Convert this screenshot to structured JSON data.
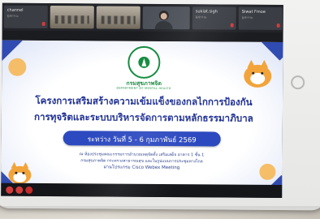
{
  "participants": [
    {
      "name": "channel",
      "status": "ผู้เข้าร่วม"
    },
    {
      "name": "",
      "status": ""
    },
    {
      "name": "",
      "status": ""
    },
    {
      "name": "",
      "status": ""
    },
    {
      "name": "sukiat.sigh",
      "status": "ผู้เข้าร่วม"
    },
    {
      "name": "Siwat Fmoe",
      "status": "ผู้เข้าร่วม"
    }
  ],
  "slide": {
    "logo_text": "กรมสุขภาพจิต",
    "logo_sub": "DEPARTMENT OF MENTAL HEALTH",
    "title_line1": "โครงการเสริมสร้างความเข้มแข็งของกลไกการป้องกัน",
    "title_line2": "การทุจริตและระบบบริหารจัดการตามหลักธรรมาภิบาล",
    "date": "ระหว่าง วันที่ 5 - 6 กุมภาพันธ์  2569",
    "venue_line1": "ณ ห้องประชุมคณะกรรมการอำนวยเหตุจัดตั้ง เสริมเสด็จ อาคาร 1 ชั้น 1",
    "venue_line2": "กรมสุขภาพจิต กระทรวงสาธารณสุข และในรูปแบบการประชุมทางไกล",
    "venue_line3": "ผ่านโปรแกรม Cisco Webex Meeting"
  },
  "colors": {
    "title": "#1e2f92",
    "date_bar": "#2c49c0",
    "logo": "#128a3c",
    "mic_muted": "#d23b3b"
  },
  "icons": [
    "microphone-muted-icon",
    "video-off-icon",
    "end-call-icon",
    "home-button-icon"
  ]
}
